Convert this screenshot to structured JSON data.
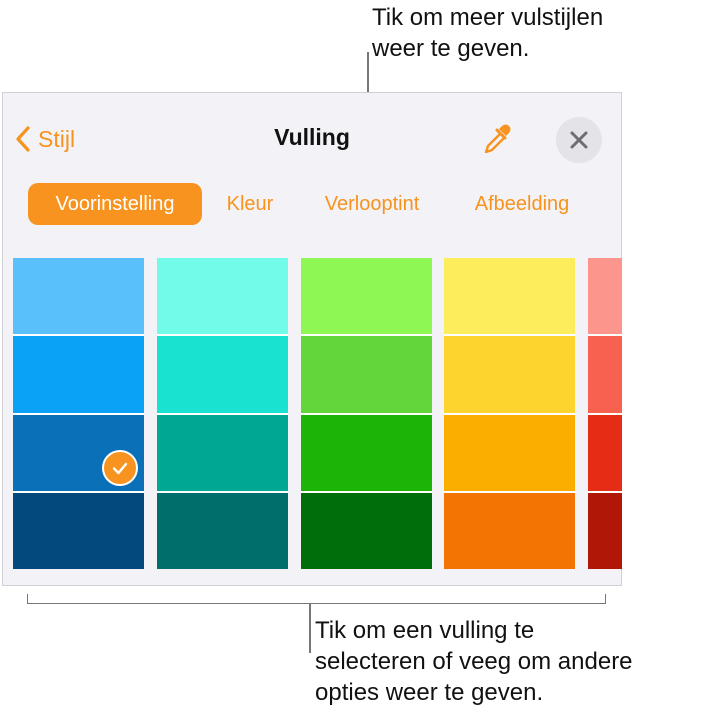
{
  "callouts": {
    "top": "Tik om meer vulstijlen\nweer te geven.",
    "bottom": "Tik om een vulling te\nselecteren of veeg om andere\nopties weer te geven."
  },
  "header": {
    "back_label": "Stijl",
    "title": "Vulling",
    "back_icon": "chevron-left-icon",
    "eyedropper_icon": "eyedropper-icon",
    "close_icon": "close-icon"
  },
  "tabs": [
    {
      "label": "Voorinstelling",
      "active": true
    },
    {
      "label": "Kleur",
      "active": false
    },
    {
      "label": "Verlooptint",
      "active": false
    },
    {
      "label": "Afbeelding",
      "active": false
    }
  ],
  "swatch_columns": [
    {
      "name": "blue",
      "colors": [
        "#5ac0fb",
        "#0aa2f7",
        "#0a70b8",
        "#03497e"
      ]
    },
    {
      "name": "teal",
      "colors": [
        "#72fbe8",
        "#19e2d0",
        "#00a894",
        "#006e6a"
      ]
    },
    {
      "name": "green",
      "colors": [
        "#8ef754",
        "#63d63c",
        "#1cb406",
        "#006e0a"
      ]
    },
    {
      "name": "yellow",
      "colors": [
        "#fdec5b",
        "#fdd32e",
        "#fbad00",
        "#f37403"
      ]
    },
    {
      "name": "red",
      "colors": [
        "#fc958c",
        "#f76150",
        "#e52c15",
        "#b01707"
      ]
    }
  ],
  "selected": {
    "column": 0,
    "row": 2
  },
  "accent_color": "#f7931e"
}
